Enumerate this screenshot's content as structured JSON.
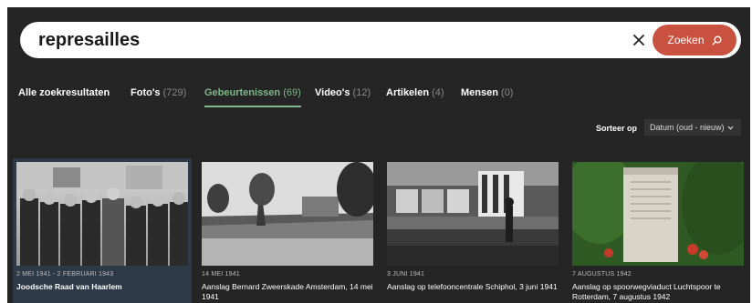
{
  "search": {
    "query": "represailles",
    "button_label": "Zoeken"
  },
  "tabs": [
    {
      "label": "Alle zoekresultaten",
      "count": ""
    },
    {
      "label": "Foto's",
      "count": "(729)"
    },
    {
      "label": "Gebeurtenissen",
      "count": "(69)"
    },
    {
      "label": "Video's",
      "count": "(12)"
    },
    {
      "label": "Artikelen",
      "count": "(4)"
    },
    {
      "label": "Mensen",
      "count": "(0)"
    }
  ],
  "active_tab": "Gebeurtenissen",
  "sort": {
    "label": "Sorteer op",
    "selected": "Datum (oud - nieuw)"
  },
  "results": [
    {
      "date": "2 MEI 1941 - 2 FEBRUARI 1943",
      "title": "Joodsche Raad van Haarlem"
    },
    {
      "date": "14 MEI 1941",
      "title": "Aanslag Bernard Zweerskade Amsterdam, 14 mei 1941"
    },
    {
      "date": "3 JUNI 1941",
      "title": "Aanslag op telefooncentrale Schiphol, 3 juni 1941"
    },
    {
      "date": "7 AUGUSTUS 1942",
      "title": "Aanslag op spoorwegviaduct Luchtspoor te Rotterdam, 7 augustus 1942"
    }
  ],
  "colors": {
    "background": "#252525",
    "accent": "#c8523f",
    "active_tab": "#7fb88a"
  },
  "icons": {
    "clear": "close-icon",
    "search": "search-icon",
    "sort": "chevron-down-icon"
  }
}
